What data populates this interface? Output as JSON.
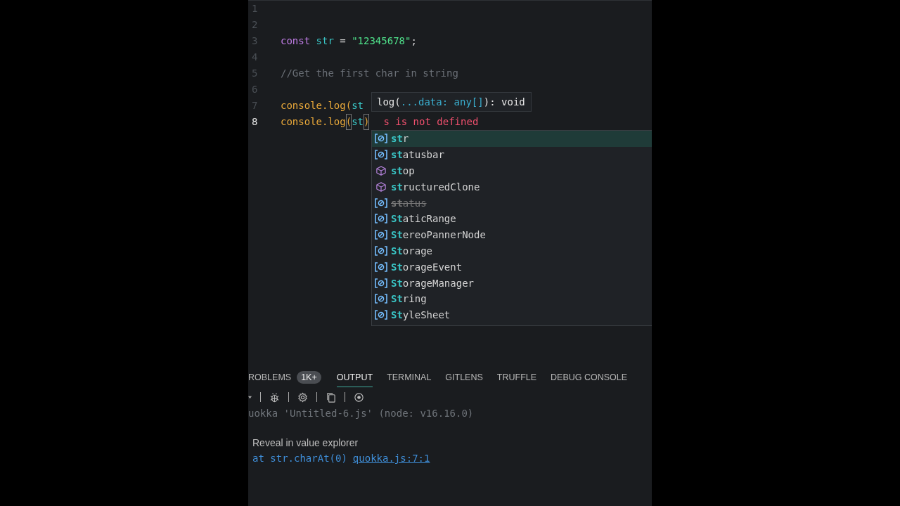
{
  "editor": {
    "lines": [
      {
        "number": "1",
        "active": false
      },
      {
        "number": "2",
        "active": false
      },
      {
        "number": "3",
        "active": false,
        "tokens": [
          {
            "kind": "keyword",
            "text": "const",
            "space_after": true
          },
          {
            "kind": "variable",
            "text": "str",
            "space_after": true
          },
          {
            "kind": "operator",
            "text": "=",
            "space_after": true
          },
          {
            "kind": "string",
            "text": "\"12345678\""
          },
          {
            "kind": "punct",
            "text": ";"
          }
        ]
      },
      {
        "number": "4",
        "active": false
      },
      {
        "number": "5",
        "active": false,
        "tokens": [
          {
            "kind": "comment",
            "text": "//Get the first char in string"
          }
        ]
      },
      {
        "number": "6",
        "active": false
      },
      {
        "number": "7",
        "active": false,
        "tokens": [
          {
            "kind": "function",
            "text": "console.log("
          },
          {
            "kind": "variable",
            "text": "st"
          }
        ]
      },
      {
        "number": "8",
        "active": true,
        "tokens": [
          {
            "kind": "function",
            "text": "console.log"
          },
          {
            "kind": "bracket",
            "text": "("
          },
          {
            "kind": "variable",
            "text": "st"
          },
          {
            "kind": "bracket",
            "text": ")"
          }
        ],
        "error": "s is not defined"
      }
    ]
  },
  "signature_hint": [
    {
      "kind": "plain",
      "text": "log("
    },
    {
      "kind": "param",
      "text": "...data: any[]"
    },
    {
      "kind": "plain",
      "text": "): void"
    }
  ],
  "suggestions": [
    {
      "kind": "variable",
      "match": "st",
      "rest": "r",
      "selected": true,
      "deprecated": false
    },
    {
      "kind": "variable",
      "match": "st",
      "rest": "atusbar",
      "selected": false,
      "deprecated": false
    },
    {
      "kind": "method",
      "match": "st",
      "rest": "op",
      "selected": false,
      "deprecated": false
    },
    {
      "kind": "method",
      "match": "st",
      "rest": "ructuredClone",
      "selected": false,
      "deprecated": false
    },
    {
      "kind": "variable",
      "match": "st",
      "rest": "atus",
      "selected": false,
      "deprecated": true
    },
    {
      "kind": "variable",
      "match": "St",
      "rest": "aticRange",
      "selected": false,
      "deprecated": false
    },
    {
      "kind": "variable",
      "match": "St",
      "rest": "ereoPannerNode",
      "selected": false,
      "deprecated": false
    },
    {
      "kind": "variable",
      "match": "St",
      "rest": "orage",
      "selected": false,
      "deprecated": false
    },
    {
      "kind": "variable",
      "match": "St",
      "rest": "orageEvent",
      "selected": false,
      "deprecated": false
    },
    {
      "kind": "variable",
      "match": "St",
      "rest": "orageManager",
      "selected": false,
      "deprecated": false
    },
    {
      "kind": "variable",
      "match": "St",
      "rest": "ring",
      "selected": false,
      "deprecated": false
    },
    {
      "kind": "variable",
      "match": "St",
      "rest": "yleSheet",
      "selected": false,
      "deprecated": false
    }
  ],
  "panel": {
    "tabs": [
      {
        "label": "ROBLEMS",
        "selected": false,
        "badge": "1K+"
      },
      {
        "label": "OUTPUT",
        "selected": true
      },
      {
        "label": "TERMINAL",
        "selected": false
      },
      {
        "label": "GITLENS",
        "selected": false
      },
      {
        "label": "TRUFFLE",
        "selected": false
      },
      {
        "label": "DEBUG CONSOLE",
        "selected": false
      }
    ],
    "output": [
      {
        "kind": "header",
        "text": "uokka 'Untitled-6.js' (node: v16.16.0)"
      },
      {
        "kind": "hint",
        "text": "Reveal in value explorer"
      },
      {
        "kind": "trace",
        "text": "at str.charAt(0)",
        "link": "quokka.js:7:1"
      }
    ]
  }
}
